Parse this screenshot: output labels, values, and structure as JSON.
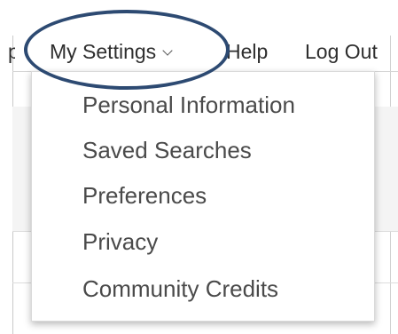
{
  "nav": {
    "cut_label": "p",
    "settings_label": "My Settings",
    "help_label": "Help",
    "logout_label": "Log Out"
  },
  "dropdown": {
    "items": [
      {
        "label": "Personal Information"
      },
      {
        "label": "Saved Searches"
      },
      {
        "label": "Preferences"
      },
      {
        "label": "Privacy"
      },
      {
        "label": "Community Credits"
      }
    ]
  },
  "colors": {
    "highlight_ring": "#2d4a72",
    "text": "#4a4a4a"
  }
}
